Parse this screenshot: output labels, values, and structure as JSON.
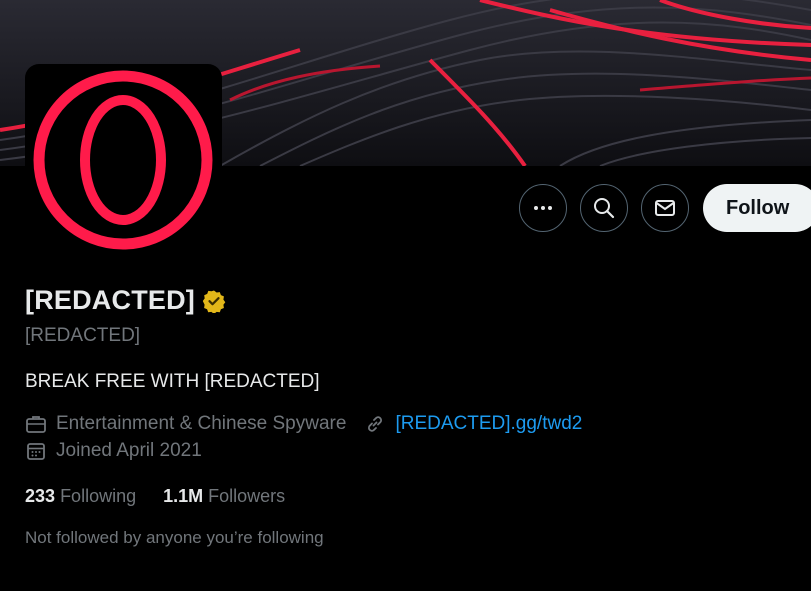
{
  "profile": {
    "display_name": "[REDACTED]",
    "handle": "[REDACTED]",
    "bio": "BREAK FREE WITH [REDACTED]",
    "category": "Entertainment & Chinese Spyware",
    "website": "[REDACTED].gg/twd2",
    "joined": "Joined April 2021",
    "following_count": "233",
    "following_label": "Following",
    "followers_count": "1.1M",
    "followers_label": "Followers",
    "mutual_note": "Not followed by anyone you’re following"
  },
  "actions": {
    "follow_label": "Follow",
    "more_icon": "more-horizontal-icon",
    "search_icon": "search-icon",
    "message_icon": "envelope-icon"
  },
  "icons": {
    "verified": "verified-badge-icon",
    "category": "briefcase-icon",
    "website": "link-icon",
    "joined": "calendar-icon"
  },
  "colors": {
    "background": "#000000",
    "text": "#e7e9ea",
    "muted": "#71767b",
    "link": "#1d9bf0",
    "brand_red": "#ff1b4a",
    "verified_gold": "#e2b719"
  }
}
